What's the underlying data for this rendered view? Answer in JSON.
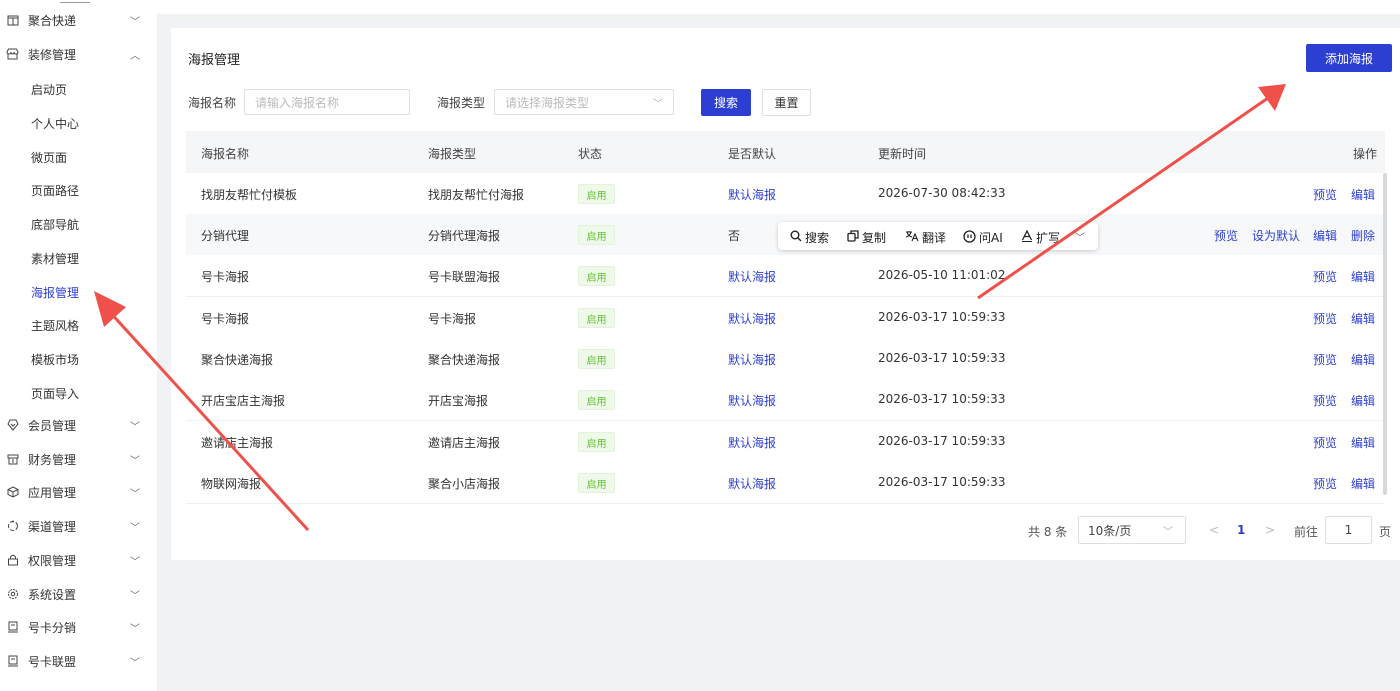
{
  "sidebar": {
    "top_item": {
      "label": "聚合快递",
      "icon": "gift-box-icon"
    },
    "decor_group": {
      "label": "装修管理",
      "icon": "store-icon"
    },
    "decor_subitems": [
      "启动页",
      "个人中心",
      "微页面",
      "页面路径",
      "底部导航",
      "素材管理",
      "海报管理",
      "主题风格",
      "模板市场",
      "页面导入"
    ],
    "active_subitem": "海报管理",
    "groups": [
      {
        "label": "会员管理",
        "icon": "heart-shield-icon"
      },
      {
        "label": "财务管理",
        "icon": "wallet-icon"
      },
      {
        "label": "应用管理",
        "icon": "cube-icon"
      },
      {
        "label": "渠道管理",
        "icon": "channel-icon"
      },
      {
        "label": "权限管理",
        "icon": "lock-icon"
      },
      {
        "label": "系统设置",
        "icon": "gear-icon"
      },
      {
        "label": "号卡分销",
        "icon": "sim-card-icon"
      },
      {
        "label": "号卡联盟",
        "icon": "sim-card-icon"
      }
    ]
  },
  "page": {
    "title": "海报管理",
    "add_button": "添加海报"
  },
  "filters": {
    "name_label": "海报名称",
    "name_placeholder": "请输入海报名称",
    "type_label": "海报类型",
    "type_placeholder": "请选择海报类型",
    "search_button": "搜索",
    "reset_button": "重置"
  },
  "table": {
    "columns": [
      "海报名称",
      "海报类型",
      "状态",
      "是否默认",
      "更新时间",
      "操作"
    ],
    "rows": [
      {
        "name": "找朋友帮忙付模板",
        "type": "找朋友帮忙付海报",
        "status": "启用",
        "default": "默认海报",
        "updated": "2026-07-30 08:42:33",
        "actions": [
          "预览",
          "编辑"
        ]
      },
      {
        "name": "分销代理",
        "type": "分销代理海报",
        "status": "启用",
        "default": "否",
        "updated": "",
        "actions": [
          "预览",
          "设为默认",
          "编辑",
          "删除"
        ]
      },
      {
        "name": "号卡海报",
        "type": "号卡联盟海报",
        "status": "启用",
        "default": "默认海报",
        "updated": "2026-05-10 11:01:02",
        "actions": [
          "预览",
          "编辑"
        ]
      },
      {
        "name": "号卡海报",
        "type": "号卡海报",
        "status": "启用",
        "default": "默认海报",
        "updated": "2026-03-17 10:59:33",
        "actions": [
          "预览",
          "编辑"
        ]
      },
      {
        "name": "聚合快递海报",
        "type": "聚合快递海报",
        "status": "启用",
        "default": "默认海报",
        "updated": "2026-03-17 10:59:33",
        "actions": [
          "预览",
          "编辑"
        ]
      },
      {
        "name": "开店宝店主海报",
        "type": "开店宝海报",
        "status": "启用",
        "default": "默认海报",
        "updated": "2026-03-17 10:59:33",
        "actions": [
          "预览",
          "编辑"
        ]
      },
      {
        "name": "邀请店主海报",
        "type": "邀请店主海报",
        "status": "启用",
        "default": "默认海报",
        "updated": "2026-03-17 10:59:33",
        "actions": [
          "预览",
          "编辑"
        ]
      },
      {
        "name": "物联网海报",
        "type": "聚合小店海报",
        "status": "启用",
        "default": "默认海报",
        "updated": "2026-03-17 10:59:33",
        "actions": [
          "预览",
          "编辑"
        ]
      }
    ]
  },
  "float_toolbar": {
    "items": [
      {
        "label": "搜索",
        "icon": "search-icon"
      },
      {
        "label": "复制",
        "icon": "copy-icon"
      },
      {
        "label": "翻译",
        "icon": "translate-icon"
      },
      {
        "label": "问AI",
        "icon": "ai-icon"
      },
      {
        "label": "扩写",
        "icon": "expand-write-icon"
      }
    ]
  },
  "pagination": {
    "total": "共 8 条",
    "page_size": "10条/页",
    "current_page": "1",
    "goto_label": "前往",
    "goto_value": "1",
    "page_unit": "页"
  },
  "colors": {
    "primary": "#2d3fd3",
    "success": "#67c23a",
    "annotation_arrow": "#f0504a"
  }
}
